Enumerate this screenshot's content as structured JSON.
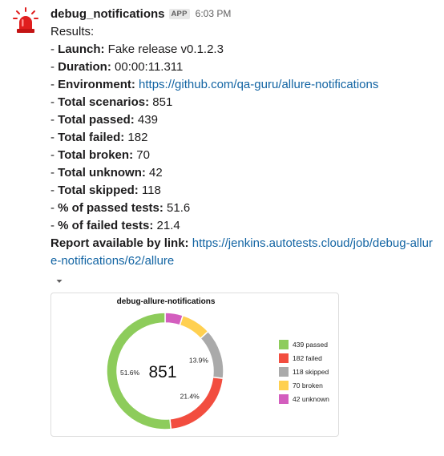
{
  "message": {
    "sender": "debug_notifications",
    "badge": "APP",
    "time": "6:03 PM",
    "results_heading": "Results:",
    "dash": "- ",
    "launch": {
      "label": "Launch:",
      "value": " Fake release v0.1.2.3"
    },
    "duration": {
      "label": "Duration:",
      "value": " 00:00:11.311"
    },
    "environment": {
      "label": "Environment:",
      "link": "https://github.com/qa-guru/allure-notifications"
    },
    "total_scenarios": {
      "label": "Total scenarios:",
      "value": " 851"
    },
    "total_passed": {
      "label": "Total passed:",
      "value": " 439"
    },
    "total_failed": {
      "label": "Total failed:",
      "value": " 182"
    },
    "total_broken": {
      "label": "Total broken:",
      "value": " 70"
    },
    "total_unknown": {
      "label": "Total unknown:",
      "value": " 42"
    },
    "total_skipped": {
      "label": "Total skipped:",
      "value": " 118"
    },
    "pct_passed": {
      "label": "% of passed tests:",
      "value": " 51.6"
    },
    "pct_failed": {
      "label": "% of failed tests:",
      "value": " 21.4"
    },
    "report": {
      "label": "Report available by link:",
      "link": "https://jenkins.autotests.cloud/job/debug-allure-notifications/62/allure"
    }
  },
  "icons": {
    "avatar": "alarm-siren-icon",
    "toggle": "caret-down-icon"
  },
  "chart_data": {
    "type": "pie",
    "title": "debug-allure-notifications",
    "center_label": "851",
    "slices": [
      {
        "name": "passed",
        "value": 439,
        "legend": "439 passed",
        "color": "#8dcc5b",
        "label": "51.6%"
      },
      {
        "name": "failed",
        "value": 182,
        "legend": "182 failed",
        "color": "#f24d3f",
        "label": "21.4%"
      },
      {
        "name": "skipped",
        "value": 118,
        "legend": "118 skipped",
        "color": "#aaaaaa",
        "label": "13.9%"
      },
      {
        "name": "broken",
        "value": 70,
        "legend": "70 broken",
        "color": "#ffd050",
        "label": ""
      },
      {
        "name": "unknown",
        "value": 42,
        "legend": "42 unknown",
        "color": "#d35ebe",
        "label": ""
      }
    ],
    "legend_placement": "right"
  }
}
